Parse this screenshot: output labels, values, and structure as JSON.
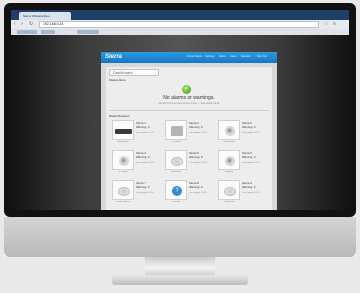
{
  "browser": {
    "tab_title": "Sierra Wireless Dev...",
    "address": "192.168.0.24"
  },
  "app": {
    "logo": "Sierra",
    "nav": [
      "Home Status",
      "Settings",
      "Alerts",
      "Users",
      "Network",
      "Sign Out"
    ],
    "dashboard_label": "Dashboard",
    "summary_label": "Status Here",
    "status_title": "No alarms or warnings.",
    "status_sub": "Monitor 5 of 9 devices across 3 sites — last update 10:24",
    "devices_label": "Client Devices",
    "devices": [
      {
        "caption": "Sierra Router",
        "name": "Sierra 1",
        "status": "Warning: 0",
        "detail": "Last update 10:24",
        "shape": "dev-router"
      },
      {
        "caption": "IP Camera",
        "name": "Sierra 2",
        "status": "Warning: 0",
        "detail": "Last update 10:24",
        "shape": "dev-box"
      },
      {
        "caption": "Sensor Node",
        "name": "Sierra 3",
        "status": "Warning: 0",
        "detail": "Last update 10:24",
        "shape": "dev-camera"
      },
      {
        "caption": "IP Camera",
        "name": "Sierra 4",
        "status": "Warning: 0",
        "detail": "Last update 10:24",
        "shape": "dev-camera"
      },
      {
        "caption": "Sensor Hub",
        "name": "Sierra 5",
        "status": "Warning: 0",
        "detail": "Last update 10:24",
        "shape": "dev-disc"
      },
      {
        "caption": "Gateway",
        "name": "Sierra 6",
        "status": "Warning: 0",
        "detail": "Last update 10:24",
        "shape": "dev-camera"
      },
      {
        "caption": "Smoke Sensor",
        "name": "Sierra 7",
        "status": "Warning: 0",
        "detail": "Last update 10:24",
        "shape": "dev-disc"
      },
      {
        "caption": "Unknown",
        "name": "Sierra 8",
        "status": "Warning: 0",
        "detail": "Last update 10:24",
        "shape": "dev-q"
      },
      {
        "caption": "Thermostat",
        "name": "Sierra 9",
        "status": "Warning: 0",
        "detail": "Last update 10:24",
        "shape": "dev-disc"
      }
    ]
  }
}
